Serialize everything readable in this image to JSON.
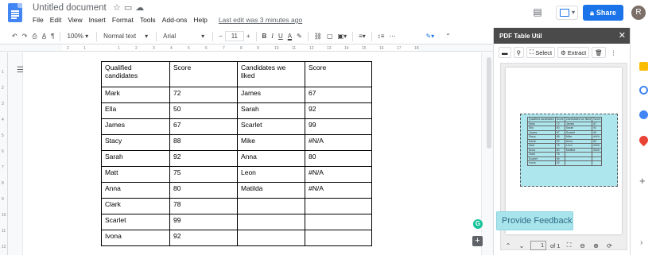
{
  "doc": {
    "title": "Untitled document",
    "title_icons": [
      "star-icon",
      "folder-move-icon",
      "cloud-saved-icon"
    ],
    "menu": [
      "File",
      "Edit",
      "View",
      "Insert",
      "Format",
      "Tools",
      "Add-ons",
      "Help"
    ],
    "last_edit": "Last edit was 3 minutes ago",
    "share_label": "Share",
    "avatar_initial": "R"
  },
  "toolbar": {
    "zoom": "100%",
    "style": "Normal text",
    "font": "Arial",
    "font_size": "11"
  },
  "ruler_ticks": [
    "2",
    "1",
    "1",
    "2",
    "3",
    "4",
    "5",
    "6",
    "7",
    "8",
    "9",
    "10",
    "11",
    "12",
    "13",
    "14",
    "15",
    "16",
    "17",
    "18"
  ],
  "vruler_ticks": [
    "1",
    "2",
    "3",
    "4",
    "5",
    "6",
    "7",
    "8",
    "9",
    "10",
    "11",
    "12"
  ],
  "table": {
    "headers": [
      "Qualified candidates",
      "Score",
      "Candidates we liked",
      "Score"
    ],
    "rows": [
      [
        "Mark",
        "72",
        "James",
        "67"
      ],
      [
        "Ella",
        "50",
        "Sarah",
        "92"
      ],
      [
        "James",
        "67",
        "Scarlet",
        "99"
      ],
      [
        "Stacy",
        "88",
        "Mike",
        "#N/A"
      ],
      [
        "Sarah",
        "92",
        "Anna",
        "80"
      ],
      [
        "Matt",
        "75",
        "Leon",
        "#N/A"
      ],
      [
        "Anna",
        "80",
        "Matilda",
        "#N/A"
      ],
      [
        "Clark",
        "78",
        "",
        ""
      ],
      [
        "Scarlet",
        "99",
        "",
        ""
      ],
      [
        "Ivona",
        "92",
        "",
        ""
      ]
    ]
  },
  "panel": {
    "title": "PDF Table Util",
    "select_label": "Select",
    "extract_label": "Extract",
    "feedback_label": "Provide Feedback",
    "page_current": "1",
    "page_total": "of 1"
  },
  "colors": {
    "docs_blue": "#4285f4",
    "share_blue": "#1a73e8",
    "panel_header": "#4a4a4a",
    "selection": "#aee6ee",
    "feedback_bg": "#a8e4ec",
    "grammarly": "#15c39a"
  }
}
